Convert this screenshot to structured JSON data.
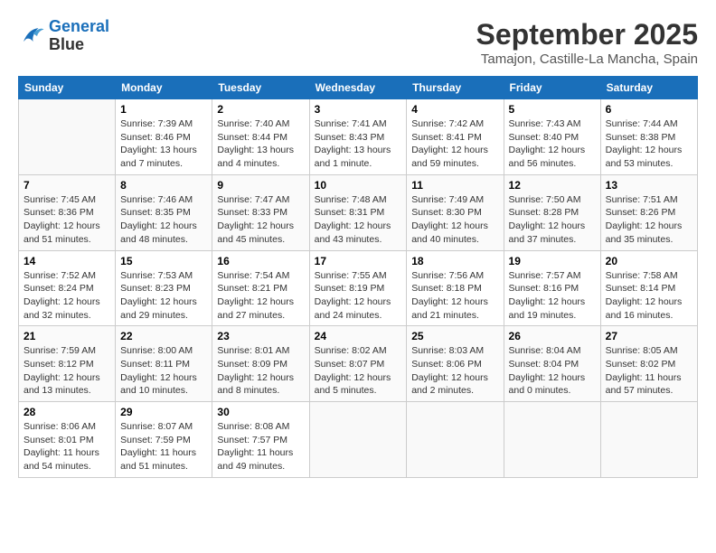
{
  "header": {
    "logo_line1": "General",
    "logo_line2": "Blue",
    "month_title": "September 2025",
    "location": "Tamajon, Castille-La Mancha, Spain"
  },
  "days_of_week": [
    "Sunday",
    "Monday",
    "Tuesday",
    "Wednesday",
    "Thursday",
    "Friday",
    "Saturday"
  ],
  "weeks": [
    [
      {
        "day": "",
        "info": ""
      },
      {
        "day": "1",
        "info": "Sunrise: 7:39 AM\nSunset: 8:46 PM\nDaylight: 13 hours\nand 7 minutes."
      },
      {
        "day": "2",
        "info": "Sunrise: 7:40 AM\nSunset: 8:44 PM\nDaylight: 13 hours\nand 4 minutes."
      },
      {
        "day": "3",
        "info": "Sunrise: 7:41 AM\nSunset: 8:43 PM\nDaylight: 13 hours\nand 1 minute."
      },
      {
        "day": "4",
        "info": "Sunrise: 7:42 AM\nSunset: 8:41 PM\nDaylight: 12 hours\nand 59 minutes."
      },
      {
        "day": "5",
        "info": "Sunrise: 7:43 AM\nSunset: 8:40 PM\nDaylight: 12 hours\nand 56 minutes."
      },
      {
        "day": "6",
        "info": "Sunrise: 7:44 AM\nSunset: 8:38 PM\nDaylight: 12 hours\nand 53 minutes."
      }
    ],
    [
      {
        "day": "7",
        "info": "Sunrise: 7:45 AM\nSunset: 8:36 PM\nDaylight: 12 hours\nand 51 minutes."
      },
      {
        "day": "8",
        "info": "Sunrise: 7:46 AM\nSunset: 8:35 PM\nDaylight: 12 hours\nand 48 minutes."
      },
      {
        "day": "9",
        "info": "Sunrise: 7:47 AM\nSunset: 8:33 PM\nDaylight: 12 hours\nand 45 minutes."
      },
      {
        "day": "10",
        "info": "Sunrise: 7:48 AM\nSunset: 8:31 PM\nDaylight: 12 hours\nand 43 minutes."
      },
      {
        "day": "11",
        "info": "Sunrise: 7:49 AM\nSunset: 8:30 PM\nDaylight: 12 hours\nand 40 minutes."
      },
      {
        "day": "12",
        "info": "Sunrise: 7:50 AM\nSunset: 8:28 PM\nDaylight: 12 hours\nand 37 minutes."
      },
      {
        "day": "13",
        "info": "Sunrise: 7:51 AM\nSunset: 8:26 PM\nDaylight: 12 hours\nand 35 minutes."
      }
    ],
    [
      {
        "day": "14",
        "info": "Sunrise: 7:52 AM\nSunset: 8:24 PM\nDaylight: 12 hours\nand 32 minutes."
      },
      {
        "day": "15",
        "info": "Sunrise: 7:53 AM\nSunset: 8:23 PM\nDaylight: 12 hours\nand 29 minutes."
      },
      {
        "day": "16",
        "info": "Sunrise: 7:54 AM\nSunset: 8:21 PM\nDaylight: 12 hours\nand 27 minutes."
      },
      {
        "day": "17",
        "info": "Sunrise: 7:55 AM\nSunset: 8:19 PM\nDaylight: 12 hours\nand 24 minutes."
      },
      {
        "day": "18",
        "info": "Sunrise: 7:56 AM\nSunset: 8:18 PM\nDaylight: 12 hours\nand 21 minutes."
      },
      {
        "day": "19",
        "info": "Sunrise: 7:57 AM\nSunset: 8:16 PM\nDaylight: 12 hours\nand 19 minutes."
      },
      {
        "day": "20",
        "info": "Sunrise: 7:58 AM\nSunset: 8:14 PM\nDaylight: 12 hours\nand 16 minutes."
      }
    ],
    [
      {
        "day": "21",
        "info": "Sunrise: 7:59 AM\nSunset: 8:12 PM\nDaylight: 12 hours\nand 13 minutes."
      },
      {
        "day": "22",
        "info": "Sunrise: 8:00 AM\nSunset: 8:11 PM\nDaylight: 12 hours\nand 10 minutes."
      },
      {
        "day": "23",
        "info": "Sunrise: 8:01 AM\nSunset: 8:09 PM\nDaylight: 12 hours\nand 8 minutes."
      },
      {
        "day": "24",
        "info": "Sunrise: 8:02 AM\nSunset: 8:07 PM\nDaylight: 12 hours\nand 5 minutes."
      },
      {
        "day": "25",
        "info": "Sunrise: 8:03 AM\nSunset: 8:06 PM\nDaylight: 12 hours\nand 2 minutes."
      },
      {
        "day": "26",
        "info": "Sunrise: 8:04 AM\nSunset: 8:04 PM\nDaylight: 12 hours\nand 0 minutes."
      },
      {
        "day": "27",
        "info": "Sunrise: 8:05 AM\nSunset: 8:02 PM\nDaylight: 11 hours\nand 57 minutes."
      }
    ],
    [
      {
        "day": "28",
        "info": "Sunrise: 8:06 AM\nSunset: 8:01 PM\nDaylight: 11 hours\nand 54 minutes."
      },
      {
        "day": "29",
        "info": "Sunrise: 8:07 AM\nSunset: 7:59 PM\nDaylight: 11 hours\nand 51 minutes."
      },
      {
        "day": "30",
        "info": "Sunrise: 8:08 AM\nSunset: 7:57 PM\nDaylight: 11 hours\nand 49 minutes."
      },
      {
        "day": "",
        "info": ""
      },
      {
        "day": "",
        "info": ""
      },
      {
        "day": "",
        "info": ""
      },
      {
        "day": "",
        "info": ""
      }
    ]
  ]
}
